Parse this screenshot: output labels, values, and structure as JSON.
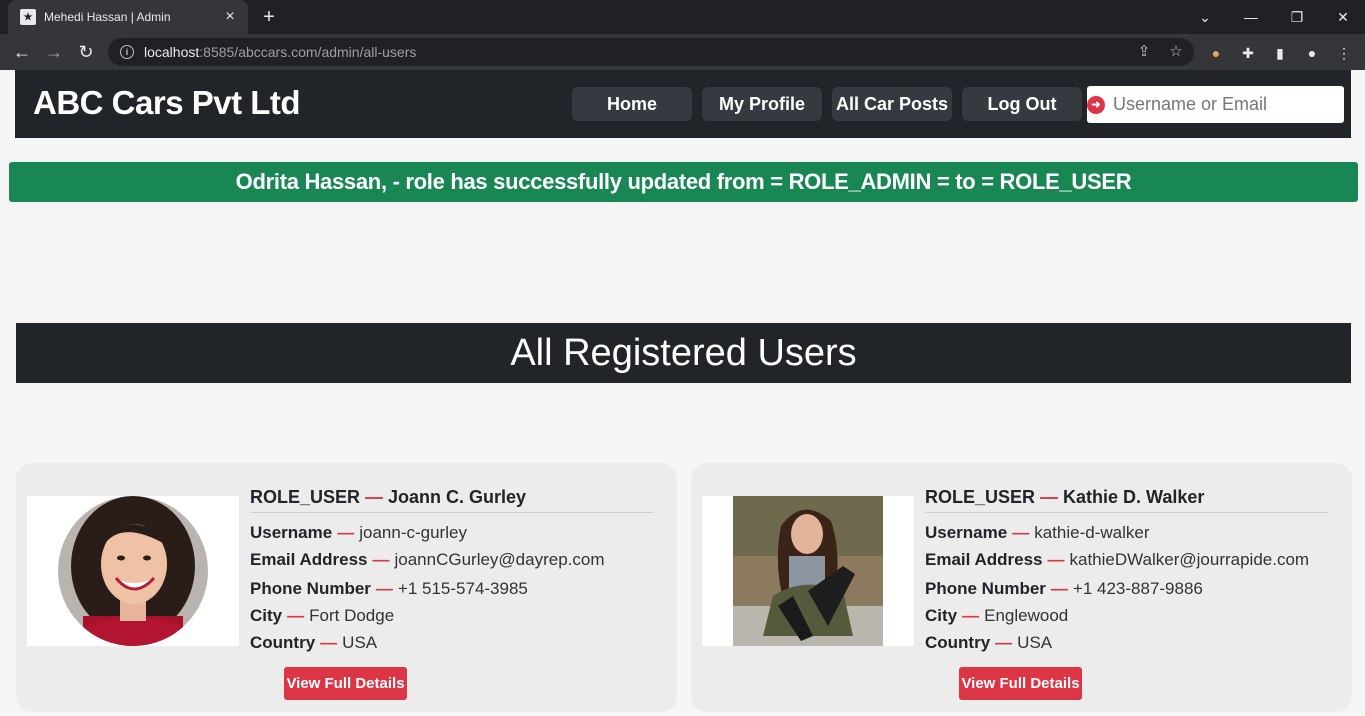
{
  "browser": {
    "tab_title": "Mehedi Hassan | Admin",
    "url_host": "localhost",
    "url_path": ":8585/abccars.com/admin/all-users"
  },
  "site": {
    "brand": "ABC Cars Pvt Ltd",
    "nav": [
      "Home",
      "My Profile",
      "All Car Posts",
      "Log Out"
    ],
    "search_placeholder": "Username or Email"
  },
  "alert": {
    "message": "Odrita Hassan, - role has successfully updated from = ROLE_ADMIN = to = ROLE_USER",
    "color": "#198754"
  },
  "section_title": "All Registered Users",
  "labels": {
    "username": "Username",
    "email": "Email Address",
    "phone": "Phone Number",
    "city": "City",
    "country": "Country",
    "dash": "—",
    "button": "View Full Details"
  },
  "users": [
    {
      "role": "ROLE_USER",
      "name": "Joann C. Gurley",
      "username": "joann-c-gurley",
      "email": "joannCGurley@dayrep.com",
      "phone": "+1 515-574-3985",
      "city": "Fort Dodge",
      "country": "USA"
    },
    {
      "role": "ROLE_USER",
      "name": "Kathie D. Walker",
      "username": "kathie-d-walker",
      "email": "kathieDWalker@jourrapide.com",
      "phone": "+1 423-887-9886",
      "city": "Englewood",
      "country": "USA"
    }
  ],
  "colors": {
    "header_bg": "#212529",
    "accent_red": "#dc3545"
  }
}
